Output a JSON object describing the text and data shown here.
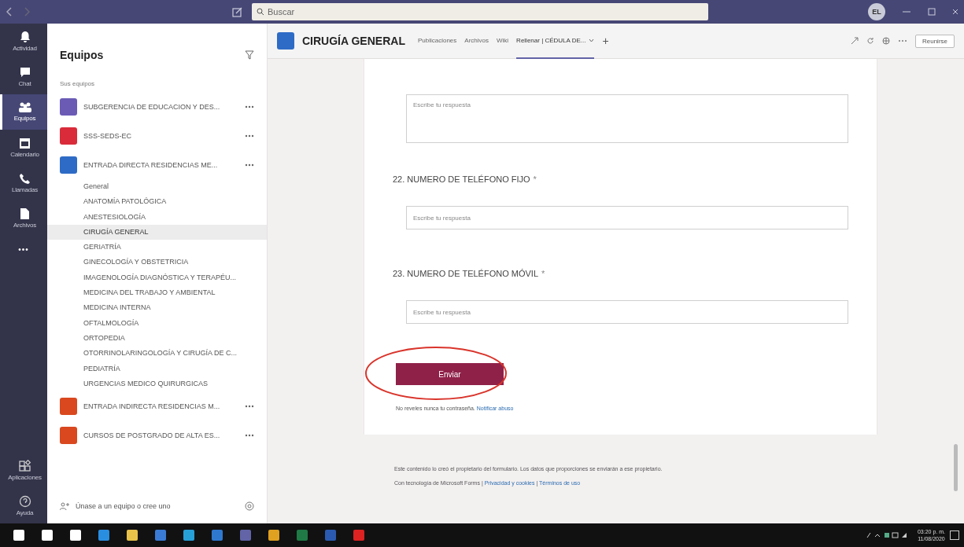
{
  "titlebar": {
    "search_placeholder": "Buscar",
    "avatar_initials": "EL"
  },
  "rail": {
    "items": [
      {
        "label": "Actividad",
        "selected": false
      },
      {
        "label": "Chat",
        "selected": false
      },
      {
        "label": "Equipos",
        "selected": true
      },
      {
        "label": "Calendario",
        "selected": false
      },
      {
        "label": "Llamadas",
        "selected": false
      },
      {
        "label": "Archivos",
        "selected": false
      }
    ],
    "more": "•••",
    "bottom": [
      {
        "label": "Aplicaciones",
        "selected": false
      },
      {
        "label": "Ayuda",
        "selected": false
      }
    ]
  },
  "sidebar": {
    "title": "Equipos",
    "section": "Sus equipos",
    "teams": [
      {
        "name": "SUBGERENCIA DE EDUCACION Y DES...",
        "color": "#6b5bb5"
      },
      {
        "name": "SSS-SEDS-EC",
        "color": "#d92b3a"
      },
      {
        "name": "ENTRADA DIRECTA RESIDENCIAS ME...",
        "color": "#2e6bc6",
        "channels": [
          {
            "name": "General",
            "selected": false
          },
          {
            "name": "ANATOMÍA PATOLÓGICA",
            "selected": false
          },
          {
            "name": "ANESTESIOLOGÍA",
            "selected": false
          },
          {
            "name": "CIRUGÍA GENERAL",
            "selected": true
          },
          {
            "name": "GERIATRÍA",
            "selected": false
          },
          {
            "name": "GINECOLOGÍA Y OBSTETRICIA",
            "selected": false
          },
          {
            "name": "IMAGENOLOGÍA DIAGNÓSTICA Y TERAPÉU...",
            "selected": false
          },
          {
            "name": "MEDICINA DEL TRABAJO Y AMBIENTAL",
            "selected": false
          },
          {
            "name": "MEDICINA INTERNA",
            "selected": false
          },
          {
            "name": "OFTALMOLOGÍA",
            "selected": false
          },
          {
            "name": "ORTOPEDIA",
            "selected": false
          },
          {
            "name": "OTORRINOLARINGOLOGÍA Y CIRUGÍA DE C...",
            "selected": false
          },
          {
            "name": "PEDIATRÍA",
            "selected": false
          },
          {
            "name": "URGENCIAS MEDICO QUIRURGICAS",
            "selected": false
          }
        ]
      },
      {
        "name": "ENTRADA INDIRECTA RESIDENCIAS M...",
        "color": "#d9481f"
      },
      {
        "name": "CURSOS DE POSTGRADO DE ALTA ES...",
        "color": "#d9481f"
      }
    ],
    "footer": "Únase a un equipo o cree uno"
  },
  "header": {
    "channel": "CIRUGÍA GENERAL",
    "tabs": [
      {
        "label": "Publicaciones",
        "selected": false
      },
      {
        "label": "Archivos",
        "selected": false
      },
      {
        "label": "Wiki",
        "selected": false
      },
      {
        "label": "Rellenar | CÉDULA DE...",
        "selected": true
      }
    ],
    "add_tab": "+",
    "meet": "Reunirse"
  },
  "form": {
    "questions": [
      {
        "kind": "long",
        "placeholder": "Escribe tu respuesta"
      },
      {
        "kind": "short",
        "label": "22. NUMERO DE TELÉFONO FIJO",
        "required": true,
        "placeholder": "Escribe tu respuesta"
      },
      {
        "kind": "short",
        "label": "23. NUMERO DE TELÉFONO MÓVIL",
        "required": true,
        "placeholder": "Escribe tu respuesta"
      }
    ],
    "required_mark": "*",
    "submit": "Enviar",
    "note": "No reveles nunca tu contraseña.",
    "note_link": "Notificar abuso",
    "footer_text": "Este contenido lo creó el propietario del formulario. Los datos que proporciones se enviarán a ese propietario.",
    "footer_prefix": "Con tecnología de Microsoft Forms",
    "separator": "|",
    "footer_links": [
      "Privacidad y cookies",
      "Términos de uso"
    ]
  },
  "taskbar": {
    "time": "03:20 p. m.",
    "date": "11/08/2020"
  }
}
